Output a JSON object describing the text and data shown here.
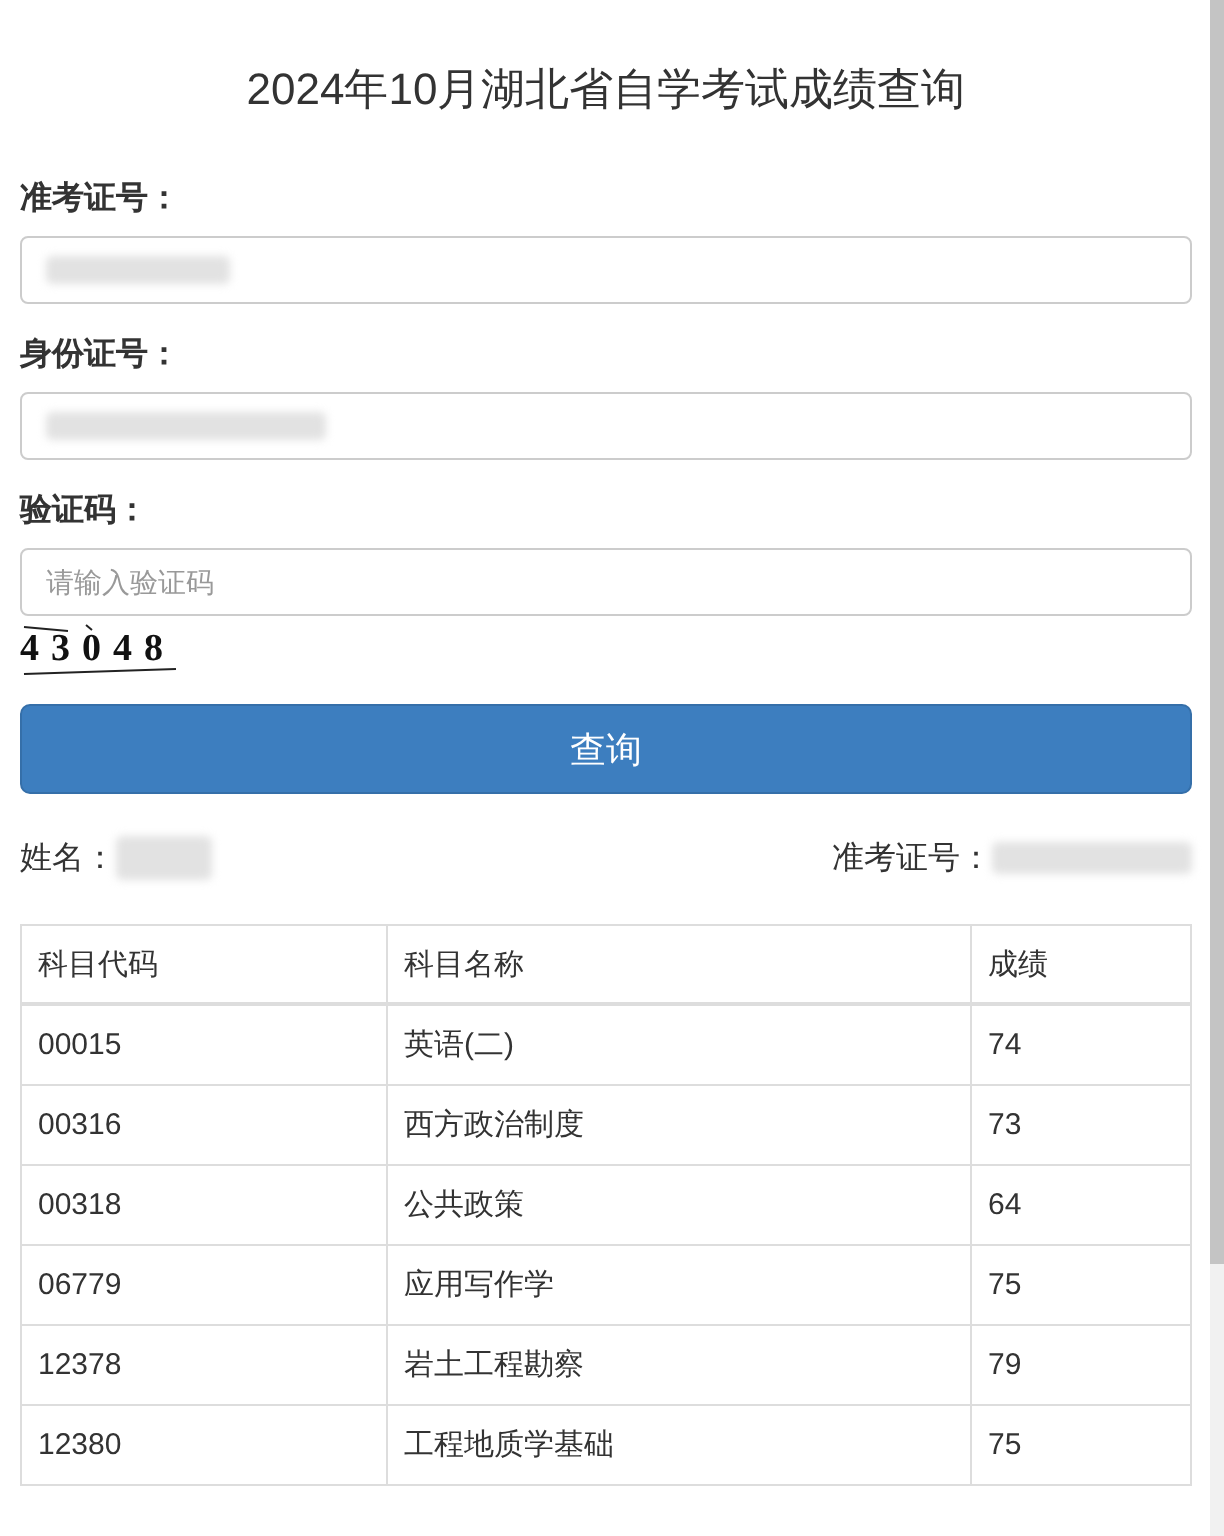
{
  "title": "2024年10月湖北省自学考试成绩查询",
  "form": {
    "fields": [
      {
        "label": "准考证号：",
        "redacted": true
      },
      {
        "label": "身份证号：",
        "redacted": true
      },
      {
        "label": "验证码：",
        "placeholder": "请输入验证码",
        "redacted": false
      }
    ],
    "captcha": "43048",
    "submit": "查询"
  },
  "result_info": [
    {
      "label": "姓名：",
      "redacted": true
    },
    {
      "label": "准考证号：",
      "redacted": true
    }
  ],
  "table": {
    "columns": [
      "科目代码",
      "科目名称",
      "成绩"
    ],
    "rows": [
      [
        "00015",
        "英语(二)",
        "74"
      ],
      [
        "00316",
        "西方政治制度",
        "73"
      ],
      [
        "00318",
        "公共政策",
        "64"
      ],
      [
        "06779",
        "应用写作学",
        "75"
      ],
      [
        "12378",
        "岩土工程勘察",
        "79"
      ],
      [
        "12380",
        "工程地质学基础",
        "75"
      ]
    ]
  }
}
